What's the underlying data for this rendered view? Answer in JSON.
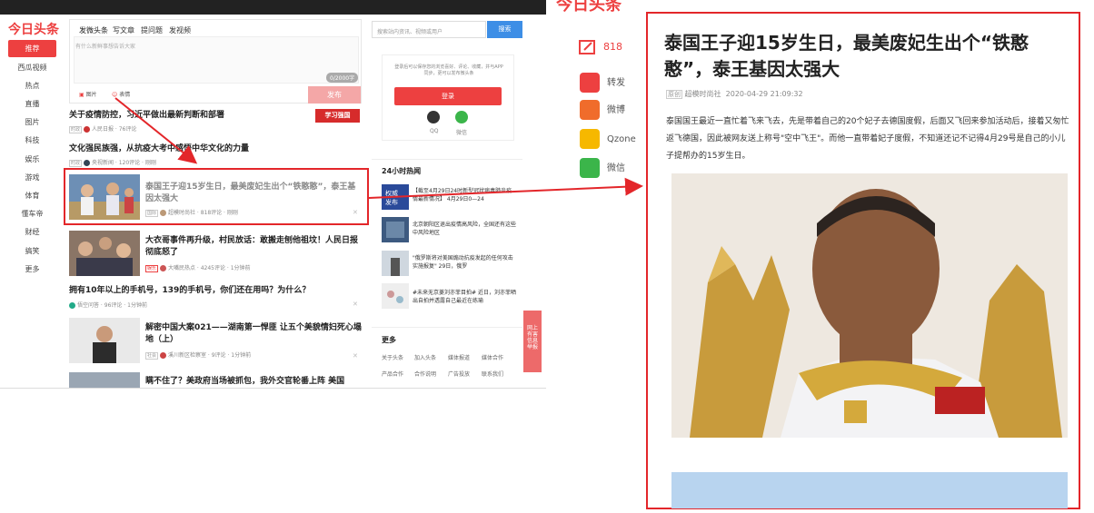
{
  "left_page": {
    "logo": "今日头条",
    "nav": [
      "推荐",
      "西瓜视频",
      "热点",
      "直播",
      "图片",
      "科技",
      "娱乐",
      "游戏",
      "体育",
      "懂车帝",
      "财经",
      "搞笑",
      "更多"
    ],
    "publish": {
      "tabs": [
        "发微头条",
        "写文章",
        "提问题",
        "发视频"
      ],
      "placeholder": "有什么新鲜事想告诉大家",
      "count": "0/2000字",
      "image_label": "图片",
      "emoji_label": "表情",
      "submit": "发布"
    },
    "feed": [
      {
        "title": "关于疫情防控，习近平做出最新判断和部署",
        "tag": "时政",
        "source": "人民日报",
        "comments": "76评论"
      },
      {
        "title": "文化强民族强，从抗疫大考中感悟中华文化的力量",
        "tag": "时政",
        "source": "央视新闻",
        "comments": "120评论",
        "time": "刚刚"
      },
      {
        "title": "泰国王子迎15岁生日，最美废妃生出个“铁憨憨”，泰王基因太强大",
        "tag": "国际",
        "source": "超模时尚社",
        "comments": "818评论",
        "time": "刚刚"
      },
      {
        "title": "大衣哥事件再升级，村民放话：敢搬走刨他祖坟！人民日报彻底怒了",
        "tag": "娱乐",
        "source": "大嘴民热点",
        "comments": "4245评论",
        "time": "1分钟前"
      },
      {
        "title": "拥有10年以上的手机号，139的手机号，你们还在用吗？为什么？",
        "source": "悟空问答",
        "comments": "96评论",
        "time": "1分钟前"
      },
      {
        "title": "解密中国大案021——湖南第一悍匪 让五个美貌情妇死心塌地（上）",
        "tag": "社会",
        "source": "溪川新区检察室",
        "comments": "9评论",
        "time": "1分钟前"
      },
      {
        "title": "瞒不住了？美政府当场被抓包，我外交官轮番上阵 美国"
      }
    ],
    "ad_label": "学习强国",
    "search_placeholder": "搜索站内资讯、视频或用户",
    "search_button": "搜索",
    "login_text": "登录后可以保存您的浏览喜好、评论、收藏，并与APP同步，更可以发布微头条",
    "login_button": "登录",
    "qq": "QQ",
    "wechat": "微信",
    "hot_title": "24小时热闻",
    "hot": [
      "【截至4月29日24时新型冠状病毒肺炎疫情最新情况】 4月29日0—24",
      "北京朝阳区退出疫情高风险，全国还有这些中风险地区",
      "\"俄罗斯将对美国煽动抗疫发起的任何攻击实施报复\" 29日，俄罗",
      "#未来无京菱刘亦菲目拍# 近日，刘亦菲晒出自拍并透露自己最近在练瑜"
    ],
    "more_title": "更多",
    "more_links": [
      "关于头条",
      "加入头条",
      "媒体报道",
      "媒体合作",
      "产品合作",
      "合作说明",
      "广告投放",
      "联系我们"
    ],
    "float_btn": "网上有害信息举报"
  },
  "right_page": {
    "logo": "今日头条",
    "comment_count": "818",
    "share": [
      "转发",
      "微博",
      "Qzone",
      "微信"
    ],
    "article": {
      "title": "泰国王子迎15岁生日，最美废妃生出个“铁憨憨”，泰王基因太强大",
      "badge": "原创",
      "author": "超模时尚社",
      "date": "2020-04-29 21:09:32",
      "body": "泰国国王最近一直忙着飞来飞去，先是带着自己的20个妃子去德国度假，后面又飞回来参加活动后，接着又匆忙返飞德国，因此被网友送上称号\"空中飞王\"。而他一直带着妃子度假，不知道还记不记得4月29号是自己的小儿子提帮办的15岁生日。"
    }
  },
  "colors": {
    "brand": "#ed4040",
    "annotation": "#e3262a",
    "search": "#3d8ee6"
  }
}
